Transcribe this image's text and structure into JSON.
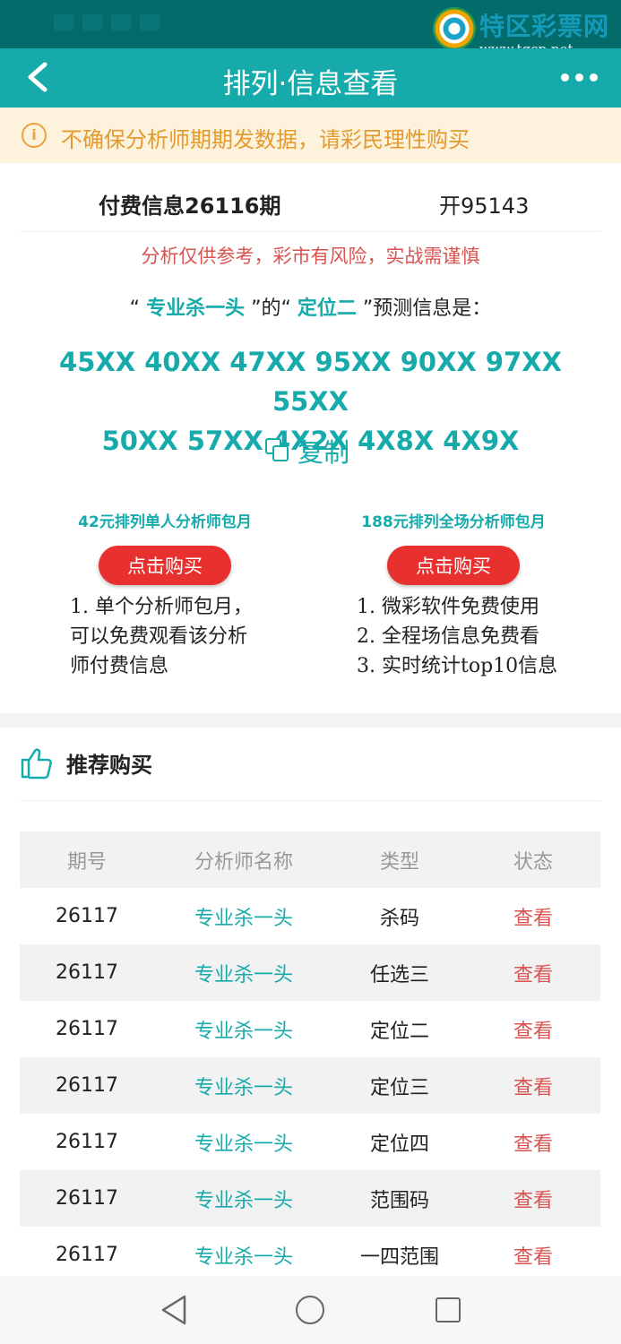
{
  "watermark": {
    "brand": "特区彩票网",
    "url": "www.tqcp.net"
  },
  "header": {
    "title": "排列·信息查看"
  },
  "notice": {
    "text": "不确保分析师期期发数据，请彩民理性购买"
  },
  "info": {
    "issue": "付费信息26116期",
    "open": "开95143",
    "warning": "分析仅供参考，彩市有风险，实战需谨慎",
    "pred_q1": "“",
    "pred_analyst": "专业杀一头",
    "pred_mid": "”的“",
    "pred_type": "定位二",
    "pred_end": "”预测信息是：",
    "numbers_line1": "45XX 40XX 47XX 95XX 90XX 97XX 55XX",
    "numbers_line2": "50XX 57XX 4X2X 4X8X 4X9X",
    "copy_label": "复制"
  },
  "packages": [
    {
      "title": "42元排列单人分析师包月",
      "button": "点击购买",
      "desc": [
        "1. 单个分析师包月，",
        "可以免费观看该分析",
        "师付费信息"
      ]
    },
    {
      "title": "188元排列全场分析师包月",
      "button": "点击购买",
      "desc": [
        "1. 微彩软件免费使用",
        "2. 全程场信息免费看",
        "3. 实时统计top10信息"
      ]
    }
  ],
  "recommend": {
    "title": "推荐购买",
    "headers": [
      "期号",
      "分析师名称",
      "类型",
      "状态"
    ],
    "rows": [
      [
        "26117",
        "专业杀一头",
        "杀码",
        "查看"
      ],
      [
        "26117",
        "专业杀一头",
        "任选三",
        "查看"
      ],
      [
        "26117",
        "专业杀一头",
        "定位二",
        "查看"
      ],
      [
        "26117",
        "专业杀一头",
        "定位三",
        "查看"
      ],
      [
        "26117",
        "专业杀一头",
        "定位四",
        "查看"
      ],
      [
        "26117",
        "专业杀一头",
        "范围码",
        "查看"
      ],
      [
        "26117",
        "专业杀一头",
        "一四范围",
        "查看"
      ]
    ]
  },
  "colors": {
    "teal": "#16aaab",
    "dark_teal": "#046b6b",
    "red": "#e8302f",
    "notice_bg": "#fdf2dc",
    "notice_text": "#e39a2e"
  }
}
